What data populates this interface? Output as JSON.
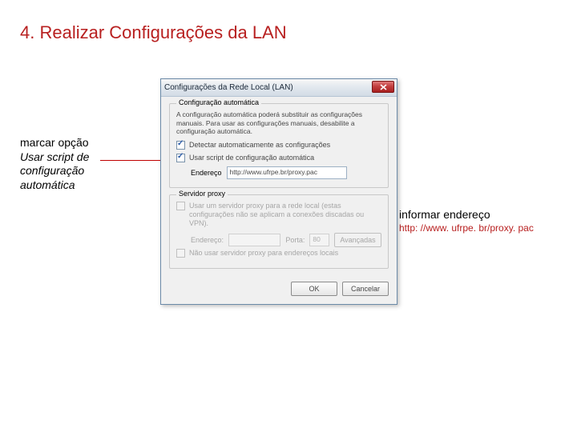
{
  "slide": {
    "title": "4. Realizar Configurações da LAN"
  },
  "annot_left": {
    "line1": "marcar opção",
    "line2": "Usar script de",
    "line3": "configuração",
    "line4": "automática"
  },
  "annot_right": {
    "title": "informar endereço",
    "url": "http: //www. ufrpe. br/proxy. pac"
  },
  "dialog": {
    "title": "Configurações da Rede Local (LAN)",
    "group_auto": {
      "title": "Configuração automática",
      "desc": "A configuração automática poderá substituir as configurações manuais. Para usar as configurações manuais, desabilite a configuração automática.",
      "detect_label": "Detectar automaticamente as configurações",
      "script_label": "Usar script de configuração automática",
      "address_label": "Endereço",
      "address_value": "http://www.ufrpe.br/proxy.pac"
    },
    "group_proxy": {
      "title": "Servidor proxy",
      "use_proxy_label": "Usar um servidor proxy para a rede local (estas configurações não se aplicam a conexões discadas ou VPN).",
      "address_label": "Endereço:",
      "port_label": "Porta:",
      "port_value": "80",
      "advanced_label": "Avançadas",
      "bypass_label": "Não usar servidor proxy para endereços locais"
    },
    "buttons": {
      "ok": "OK",
      "cancel": "Cancelar"
    }
  }
}
